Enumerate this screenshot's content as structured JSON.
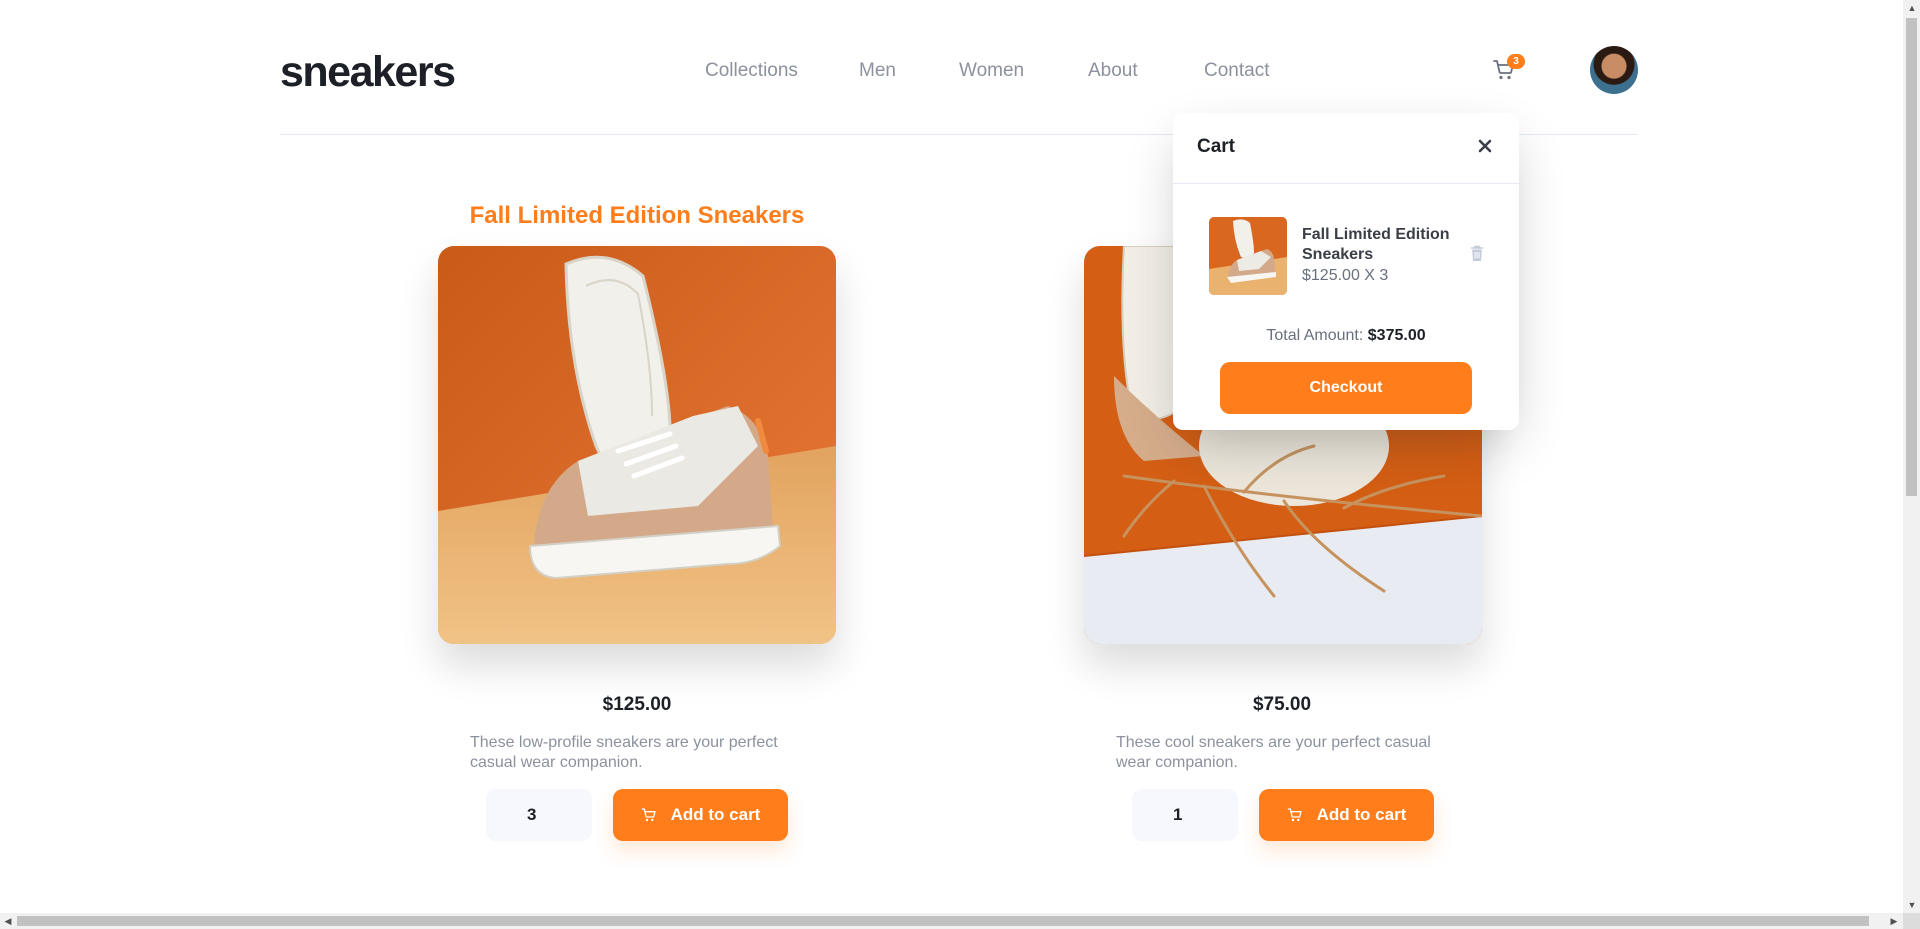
{
  "header": {
    "logo": "sneakers",
    "nav": [
      "Collections",
      "Men",
      "Women",
      "About",
      "Contact"
    ],
    "cart_count": "3"
  },
  "products": [
    {
      "title": "Fall Limited Edition Sneakers",
      "price": "$125.00",
      "description": "These low-profile sneakers are your perfect casual wear companion.",
      "quantity": "3",
      "add_label": "Add to cart"
    },
    {
      "title": "",
      "price": "$75.00",
      "description": "These cool sneakers are your perfect casual wear companion.",
      "quantity": "1",
      "add_label": "Add to cart"
    }
  ],
  "cart": {
    "title": "Cart",
    "item": {
      "name": "Fall Limited Edition Sneakers",
      "price_line": "$125.00 X 3"
    },
    "total_label": "Total Amount:",
    "total_value": "$375.00",
    "checkout_label": "Checkout"
  },
  "colors": {
    "accent": "#ff7e1b",
    "text_dark": "#1d2026",
    "text_muted": "#8c919e"
  },
  "icons": [
    "cart-icon",
    "close-icon",
    "trash-icon",
    "avatar",
    "scroll-arrow-icon"
  ]
}
